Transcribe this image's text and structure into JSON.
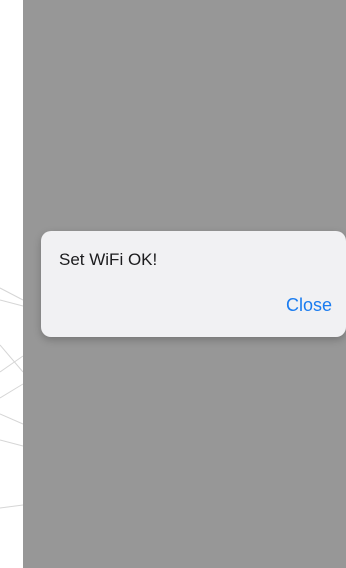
{
  "colors": {
    "overlay": "#979797",
    "alert_background": "#f1f1f3",
    "accent": "#1a7cf0"
  },
  "alert": {
    "message": "Set WiFi OK!",
    "close_label": "Close"
  }
}
